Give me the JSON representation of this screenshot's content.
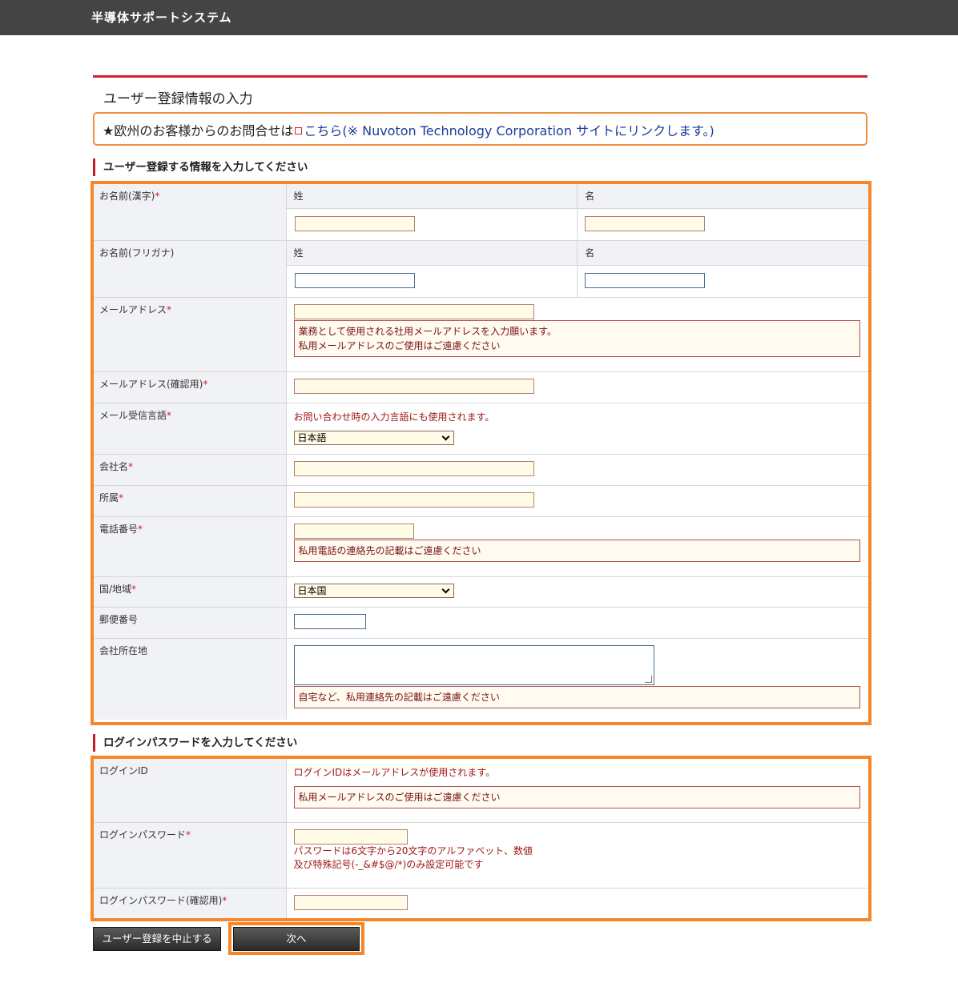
{
  "header": {
    "system_title": "半導体サポートシステム"
  },
  "page": {
    "title": "ユーザー登録情報の入力"
  },
  "notice": {
    "prefix": "★欧州のお客様からのお問合せは",
    "link": "こちら(※ Nuvoton Technology Corporation サイトにリンクします。)",
    "icon": "external-link-icon"
  },
  "section_user": {
    "heading": "ユーザー登録する情報を入力してください",
    "name_kanji": {
      "label": "お名前(漢字)",
      "req": "*",
      "last_label": "姓",
      "first_label": "名"
    },
    "name_kana": {
      "label": "お名前(フリガナ)",
      "last_label": "姓",
      "first_label": "名"
    },
    "email": {
      "label": "メールアドレス",
      "req": "*",
      "note_1": "業務として使用される社用メールアドレスを入力願います。",
      "note_2": "私用メールアドレスのご使用はご遠慮ください"
    },
    "email_confirm": {
      "label": "メールアドレス(確認用)",
      "req": "*"
    },
    "mail_lang": {
      "label": "メール受信言語",
      "req": "*",
      "hint": "お問い合わせ時の入力言語にも使用されます。",
      "selected": "日本語"
    },
    "company": {
      "label": "会社名",
      "req": "*"
    },
    "department": {
      "label": "所属",
      "req": "*"
    },
    "phone": {
      "label": "電話番号",
      "req": "*",
      "note": "私用電話の連絡先の記載はご遠慮ください"
    },
    "country": {
      "label": "国/地域",
      "req": "*",
      "selected": "日本国"
    },
    "postal": {
      "label": "郵便番号"
    },
    "address": {
      "label": "会社所在地",
      "note": "自宅など、私用連絡先の記載はご遠慮ください"
    }
  },
  "section_login": {
    "heading": "ログインパスワードを入力してください",
    "login_id": {
      "label": "ログインID",
      "hint": "ログインIDはメールアドレスが使用されます。",
      "note": "私用メールアドレスのご使用はご遠慮ください"
    },
    "password": {
      "label": "ログインパスワード",
      "req": "*",
      "rule_1": "パスワードは6文字から20文字のアルファベット、数値",
      "rule_2": "及び特殊記号(-_&#$@/*)のみ設定可能です"
    },
    "password_confirm": {
      "label": "ログインパスワード(確認用)",
      "req": "*"
    }
  },
  "buttons": {
    "cancel": "ユーザー登録を中止する",
    "next": "次へ"
  }
}
